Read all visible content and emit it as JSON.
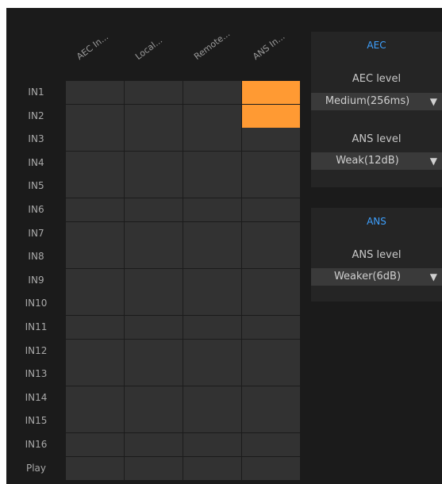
{
  "matrix": {
    "columns": [
      "AEC In...",
      "Local...",
      "Remote...",
      "ANS In..."
    ],
    "rows": [
      "IN1",
      "IN2",
      "IN3",
      "IN4",
      "IN5",
      "IN6",
      "IN7",
      "IN8",
      "IN9",
      "IN10",
      "IN11",
      "IN12",
      "IN13",
      "IN14",
      "IN15",
      "IN16",
      "Play"
    ],
    "active": [
      [
        0,
        3
      ],
      [
        1,
        3
      ]
    ]
  },
  "aec_panel": {
    "title": "AEC",
    "aec_level_label": "AEC level",
    "aec_level_value": "Medium(256ms)",
    "ans_level_label": "ANS level",
    "ans_level_value": "Weak(12dB)"
  },
  "ans_panel": {
    "title": "ANS",
    "ans_level_label": "ANS level",
    "ans_level_value": "Weaker(6dB)"
  },
  "colors": {
    "active_cell": "#ff9a33",
    "inactive_cell": "#323232",
    "panel_title": "#3ea1ff"
  }
}
